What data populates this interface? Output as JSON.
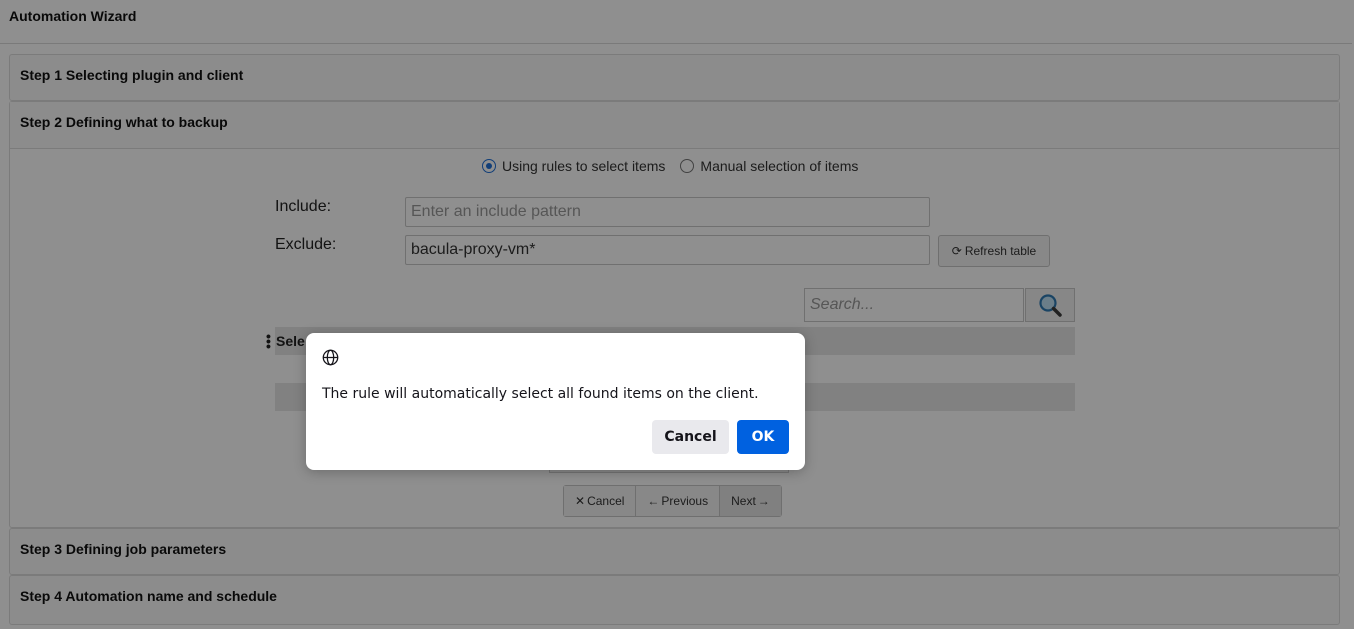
{
  "window": {
    "title": "Automation Wizard"
  },
  "steps": [
    {
      "label": "Step 1 Selecting plugin and client"
    },
    {
      "label": "Step 2 Defining what to backup"
    },
    {
      "label": "Step 3 Defining job parameters"
    },
    {
      "label": "Step 4 Automation name and schedule"
    }
  ],
  "selection_mode": {
    "options": [
      {
        "label": "Using rules to select items",
        "checked": true
      },
      {
        "label": "Manual selection of items",
        "checked": false
      }
    ]
  },
  "form": {
    "include_label": "Include:",
    "include_value": "",
    "include_placeholder": "Enter an include pattern",
    "exclude_label": "Exclude:",
    "exclude_value": "bacula-proxy-vm*",
    "refresh_label": "Refresh table"
  },
  "search": {
    "placeholder": "Search..."
  },
  "table": {
    "header_partial": "Sele"
  },
  "nav": {
    "cancel_label": "Cancel",
    "previous_label": "Previous",
    "next_label": "Next"
  },
  "dialog": {
    "icon": "globe-icon",
    "message": "The rule will automatically select all found items on the client.",
    "cancel_label": "Cancel",
    "ok_label": "OK"
  },
  "colors": {
    "accent": "#0061e0",
    "radio": "#1f6fd6"
  }
}
